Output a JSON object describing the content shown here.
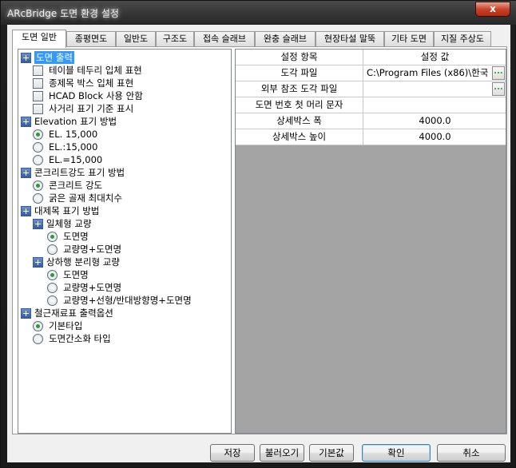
{
  "window": {
    "title": "ARcBridge 도면 환경 설정",
    "close_label": "x"
  },
  "tabs": [
    {
      "label": "도면 일반"
    },
    {
      "label": "종평면도"
    },
    {
      "label": "일반도"
    },
    {
      "label": "구조도"
    },
    {
      "label": "접속 슬래브"
    },
    {
      "label": "완충 슬래브"
    },
    {
      "label": "현장타설 말뚝"
    },
    {
      "label": "기타 도면"
    },
    {
      "label": "지질 주상도"
    }
  ],
  "tree": {
    "items": [
      {
        "type": "folder",
        "label": "도면 출력",
        "selected": true
      },
      {
        "type": "check",
        "label": "테이블 테두리 입체 표현",
        "checked": false
      },
      {
        "type": "check",
        "label": "종제목 박스 입체 표현",
        "checked": false
      },
      {
        "type": "check",
        "label": "HCAD Block 사용 안함",
        "checked": false
      },
      {
        "type": "check",
        "label": "사거리 표기 기준 표시",
        "checked": false
      },
      {
        "type": "folder",
        "label": "Elevation 표기 방법"
      },
      {
        "type": "radio",
        "label": "EL. 15,000",
        "checked": true
      },
      {
        "type": "radio",
        "label": "EL.:15,000",
        "checked": false
      },
      {
        "type": "radio",
        "label": "EL.=15,000",
        "checked": false
      },
      {
        "type": "folder",
        "label": "콘크리트강도 표기 방법"
      },
      {
        "type": "radio",
        "label": "콘크리트 강도",
        "checked": true
      },
      {
        "type": "radio",
        "label": "굵은 골재 최대치수",
        "checked": false
      },
      {
        "type": "folder",
        "label": "대제목 표기 방법"
      },
      {
        "type": "folder",
        "label": "일체형 교량"
      },
      {
        "type": "radio",
        "label": "도면명",
        "checked": true
      },
      {
        "type": "radio",
        "label": "교량명+도면명",
        "checked": false
      },
      {
        "type": "folder",
        "label": "상하행 분리형 교량"
      },
      {
        "type": "radio",
        "label": "도면명",
        "checked": true
      },
      {
        "type": "radio",
        "label": "교량명+도면명",
        "checked": false
      },
      {
        "type": "radio",
        "label": "교량명+선형/반대방향명+도면명",
        "checked": false
      },
      {
        "type": "folder",
        "label": "철근재료표 출력옵션"
      },
      {
        "type": "radio",
        "label": "기본타입",
        "checked": true
      },
      {
        "type": "radio",
        "label": "도면간소화 타입",
        "checked": false
      }
    ]
  },
  "grid": {
    "header": {
      "col1": "설정 항목",
      "col2": "설정 값"
    },
    "rows": [
      {
        "item": "도각 파일",
        "value": "C:\\Program Files (x86)\\한국",
        "has_button": true
      },
      {
        "item": "외부 참조 도각 파일",
        "value": "",
        "has_button": true
      },
      {
        "item": "도면 번호 첫 머리 문자",
        "value": "",
        "has_button": false
      },
      {
        "item": "상세박스 폭",
        "value": "4000.0",
        "has_button": false
      },
      {
        "item": "상세박스 높이",
        "value": "4000.0",
        "has_button": false
      }
    ],
    "browse_label": "..."
  },
  "buttons": {
    "save": "저장",
    "load": "불러오기",
    "default": "기본값",
    "ok": "확인",
    "cancel": "취소"
  }
}
